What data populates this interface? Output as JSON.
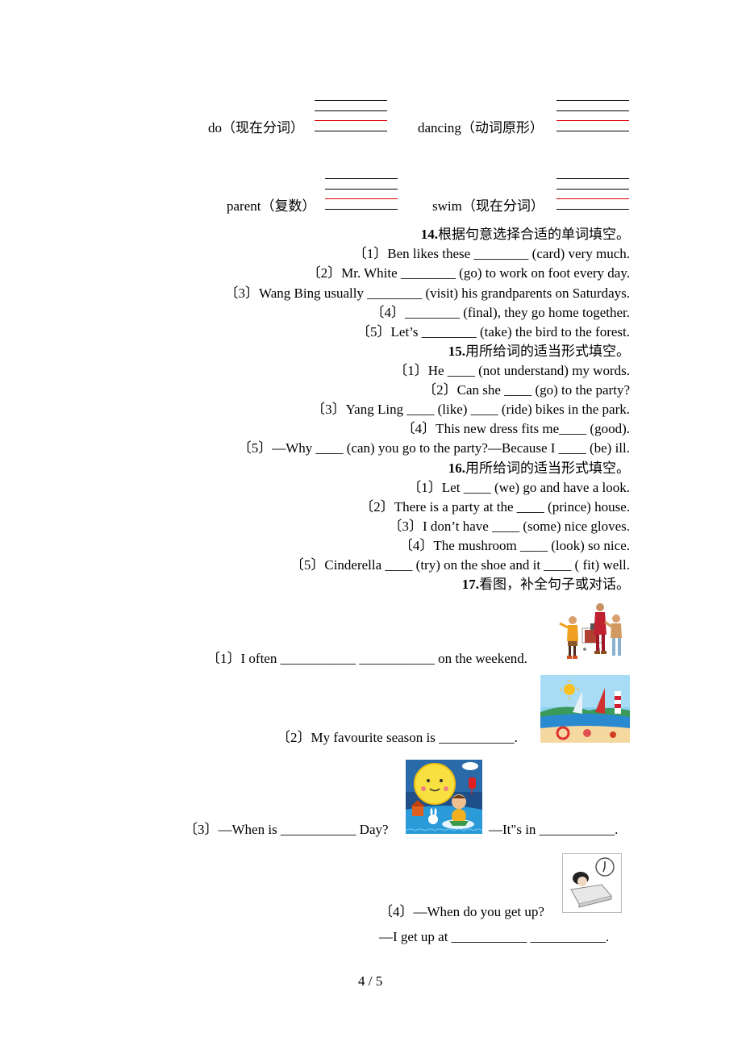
{
  "wordforms": [
    {
      "word": "do",
      "hint": "（现在分词）"
    },
    {
      "word": "dancing",
      "hint": "（动词原形）"
    },
    {
      "word": "parent",
      "hint": "（复数）"
    },
    {
      "word": "swim",
      "hint": "（现在分词）"
    }
  ],
  "section14": {
    "number": "14.",
    "title": "根据句意选择合适的单词填空。",
    "items": [
      "〔1〕Ben likes these ________ (card) very much.",
      "〔2〕Mr. White ________ (go) to work on foot every day.",
      "〔3〕Wang Bing usually ________ (visit) his grandparents on Saturdays.",
      "〔4〕________ (final), they go home together.",
      "〔5〕Let’s ________ (take) the bird to the forest."
    ]
  },
  "section15": {
    "number": "15.",
    "title": "用所给词的适当形式填空。",
    "items": [
      "〔1〕He ____ (not understand) my words.",
      "〔2〕Can she ____ (go) to the party?",
      "〔3〕Yang Ling ____ (like) ____ (ride) bikes in the park.",
      "〔4〕This new dress fits me____ (good).",
      "〔5〕—Why ____ (can) you go to the party?—Because I ____ (be) ill."
    ]
  },
  "section16": {
    "number": "16.",
    "title": "用所给词的适当形式填空。",
    "items": [
      "〔1〕Let ____ (we) go and have a look.",
      "〔2〕There is a party at the ____ (prince) house.",
      "〔3〕I don’t have ____ (some) nice gloves.",
      "〔4〕The mushroom ____ (look) so nice.",
      "〔5〕Cinderella ____ (try) on the shoe and it ____ ( fit) well."
    ]
  },
  "section17": {
    "number": "17.",
    "title": "看图，补全句子或对话。",
    "items": [
      {
        "text": "〔1〕I often ___________ ___________ on the weekend.",
        "image": "family-shopping-picture"
      },
      {
        "text": "〔2〕My favourite season is ___________.",
        "image": "summer-beach-picture"
      },
      {
        "text_before": "〔3〕—When is ___________ Day?",
        "text_after": "—It\"s in ___________.",
        "image": "mid-autumn-moon-picture"
      },
      {
        "text": "〔4〕—When do you get up?",
        "text2": "—I get up at ___________ ___________.",
        "image": "bed-alarm-clock-picture"
      }
    ]
  },
  "footer": {
    "page": "4 / 5"
  }
}
